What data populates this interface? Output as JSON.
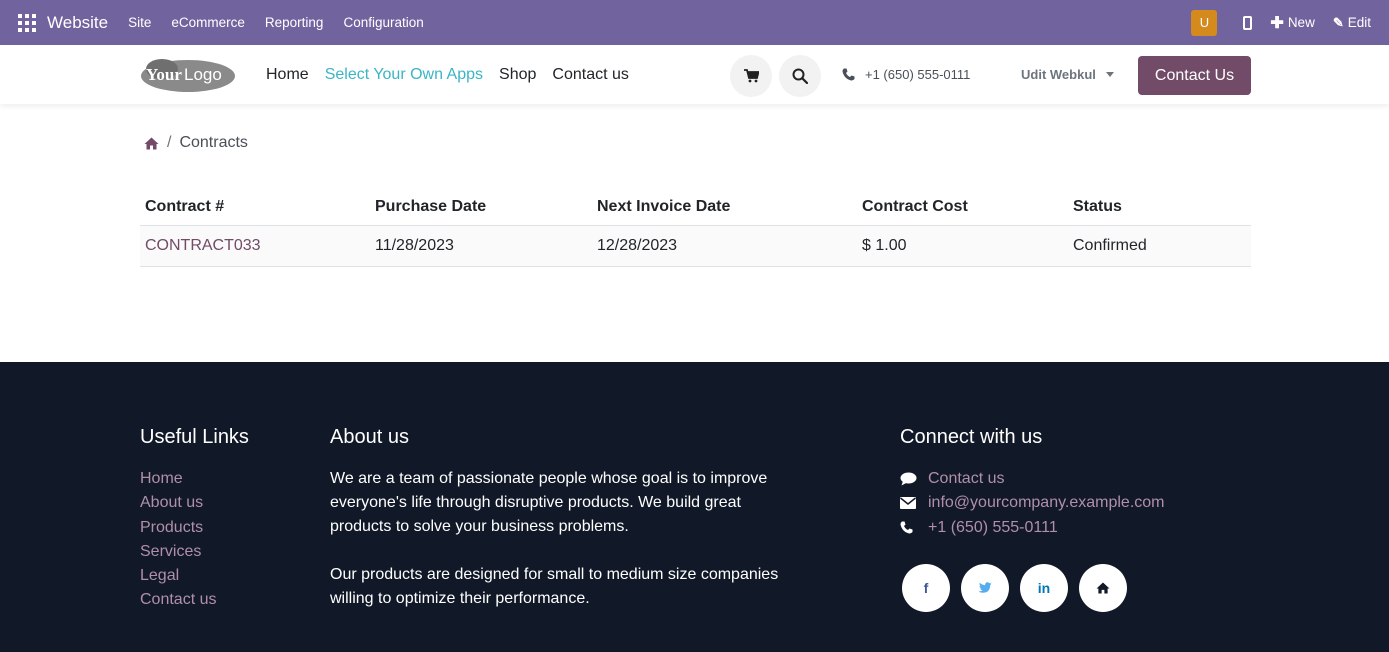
{
  "adminbar": {
    "brand": "Website",
    "menu": [
      "Site",
      "eCommerce",
      "Reporting",
      "Configuration"
    ],
    "avatar_letter": "U",
    "new_label": "New",
    "edit_label": "Edit",
    "bg_color": "#71639e"
  },
  "header": {
    "logo_text": "YourLogo",
    "nav": [
      "Home",
      "Select Your Own Apps",
      "Shop",
      "Contact us"
    ],
    "active_nav": "Select Your Own Apps",
    "phone": "+1 (650) 555-0111",
    "user": "Udit Webkul",
    "cta": "Contact Us",
    "accent_color": "#714b67"
  },
  "breadcrumb": {
    "current": "Contracts"
  },
  "table": {
    "columns": [
      "Contract #",
      "Purchase Date",
      "Next Invoice Date",
      "Contract Cost",
      "Status"
    ],
    "rows": [
      [
        "CONTRACT033",
        "11/28/2023",
        "12/28/2023",
        "$ 1.00",
        "Confirmed"
      ]
    ]
  },
  "footer": {
    "useful_links": {
      "title": "Useful Links",
      "items": [
        "Home",
        "About us",
        "Products",
        "Services",
        "Legal",
        "Contact us"
      ]
    },
    "about": {
      "title": "About us",
      "p1": "We are a team of passionate people whose goal is to improve everyone's life through disruptive products. We build great products to solve your business problems.",
      "p2": "Our products are designed for small to medium size companies willing to optimize their performance."
    },
    "connect": {
      "title": "Connect with us",
      "contact": "Contact us",
      "email": "info@yourcompany.example.com",
      "phone": "+1 (650) 555-0111",
      "socials": {
        "facebook": "f",
        "linkedin": "in"
      }
    },
    "bg_color": "#111827"
  }
}
